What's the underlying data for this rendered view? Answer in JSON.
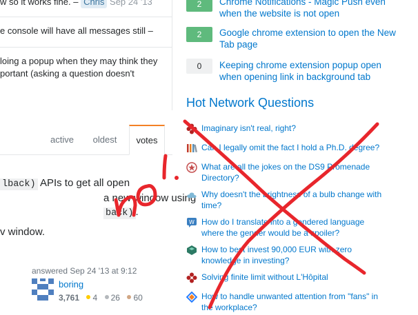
{
  "comments": [
    {
      "text": "w so it works fine. –",
      "user": "Chris",
      "date": "Sep 24 '13"
    },
    {
      "text": "e console will have all messages still –"
    },
    {
      "line1": "loing a popup when they may think they",
      "line2": "portant (asking a question doesn't"
    }
  ],
  "tabs": {
    "active": "active",
    "oldest": "oldest",
    "votes": "votes"
  },
  "answer": {
    "line1_code": "lback)",
    "line1_rest": "APIs to get all open",
    "line2": "a new window using",
    "line3_code": "back)",
    "line3_rest": ".",
    "line4": "v window."
  },
  "signature": {
    "action": "answered Sep 24 '13 at 9:12",
    "user": "boring",
    "reputation": "3,761",
    "gold": "4",
    "silver": "26",
    "bronze": "60"
  },
  "linked": [
    {
      "score": "2",
      "answered": true,
      "title": "Chrome Notifications - Magic Push even when the website is not open"
    },
    {
      "score": "2",
      "answered": true,
      "title": "Google chrome extension to open the New Tab page"
    },
    {
      "score": "0",
      "answered": false,
      "title": "Keeping chrome extension popup open when opening link in background tab"
    }
  ],
  "hot_network": {
    "title": "Hot Network Questions",
    "items": [
      {
        "icon": "math-site-icon",
        "color": "#b22222",
        "text": "Imaginary isn't real, right?"
      },
      {
        "icon": "academia-site-icon",
        "color": "#5a8fb4",
        "text": "Can I legally omit the fact I hold a Ph.D. degree?"
      },
      {
        "icon": "puzzling-site-icon",
        "color": "#c44d4d",
        "text": "What are all the jokes on the DS9 Promenade Directory?"
      },
      {
        "icon": "physics-site-icon",
        "color": "#7fb8d6",
        "text": "Why doesn't the brightness of a bulb change with time?"
      },
      {
        "icon": "linguistics-site-icon",
        "color": "#3a7fc1",
        "text": "How do I translate into a gendered language where the gender would be a spoiler?"
      },
      {
        "icon": "money-site-icon",
        "color": "#2c7a64",
        "text": "How to best invest 90,000 EUR with zero knowledge in investing?"
      },
      {
        "icon": "math-site-icon",
        "color": "#b22222",
        "text": "Solving finite limit without L'Hôpital"
      },
      {
        "icon": "workplace-site-icon",
        "color": "#2a7fff",
        "text": "How to handle unwanted attention from \"fans\" in the workplace?"
      }
    ]
  },
  "annotation": {
    "text": "no!",
    "color": "#e8262c"
  }
}
